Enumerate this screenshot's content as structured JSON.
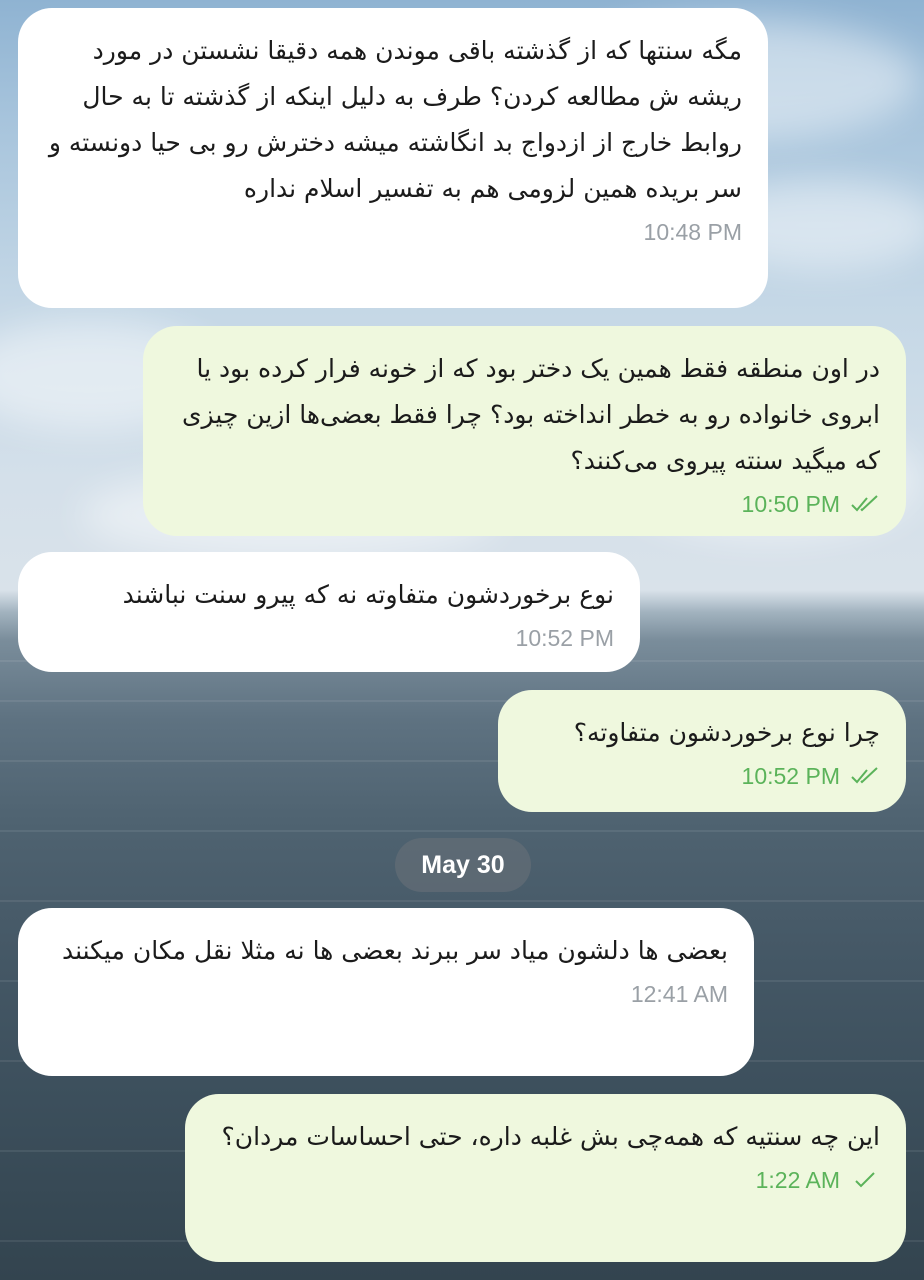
{
  "messages": [
    {
      "direction": "incoming",
      "text": "مگه سنتها که از گذشته باقی موندن همه دقیقا نشستن در مورد ریشه ش مطالعه کردن؟ طرف به دلیل اینکه از گذشته تا به حال روابط خارج از ازدواج بد انگاشته میشه دخترش رو بی حیا دونسته و سر بریده همین لزومی هم به تفسیر اسلام نداره",
      "time": "10:48 PM"
    },
    {
      "direction": "outgoing",
      "text": "در اون منطقه فقط همین یک دختر بود که از خونه فرار کرده بود یا ابروی خانواده رو به خطر انداخته بود؟ چرا فقط بعضی‌ها ازین چیزی که میگید سنته پیروی می‌کنند؟",
      "time": "10:50 PM",
      "status": "read"
    },
    {
      "direction": "incoming",
      "text": "نوع برخوردشون متفاوته نه که پیرو سنت نباشند",
      "time": "10:52 PM"
    },
    {
      "direction": "outgoing",
      "text": "چرا نوع برخوردشون متفاوته؟",
      "time": "10:52 PM",
      "status": "read"
    },
    {
      "direction": "incoming",
      "text": "بعضی ها دلشون میاد سر ببرند بعضی ها نه مثلا نقل مکان میکنند",
      "time": "12:41 AM"
    },
    {
      "direction": "outgoing",
      "text": "این چه سنتیه که همه‌چی بش غلبه داره، حتی احساسات مردان؟",
      "time": "1:22 AM",
      "status": "sent"
    }
  ],
  "date_separator": "May 30",
  "colors": {
    "incoming_bubble": "#ffffff",
    "outgoing_bubble": "#eff8de",
    "outgoing_meta": "#5bb35a",
    "incoming_meta": "#9aa0a6"
  }
}
